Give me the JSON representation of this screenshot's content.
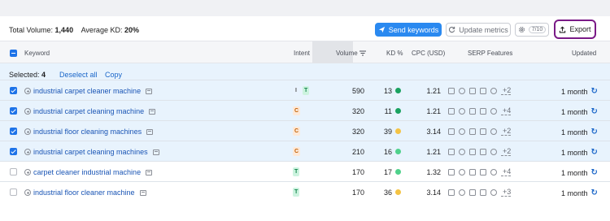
{
  "toolbar": {
    "totals_label": "Total Volume:",
    "totals_value": "1,440",
    "kd_label": "Average KD:",
    "kd_value": "20%",
    "send_label": "Send keywords",
    "update_label": "Update metrics",
    "gear_count": "7/10",
    "export_label": "Export"
  },
  "columns": {
    "keyword": "Keyword",
    "intent": "Intent",
    "volume": "Volume",
    "kd": "KD %",
    "cpc": "CPC (USD)",
    "serp": "SERP Features",
    "updated": "Updated"
  },
  "selection": {
    "label": "Selected:",
    "count": "4",
    "deselect": "Deselect all",
    "copy": "Copy"
  },
  "rows": [
    {
      "keyword": "industrial carpet cleaner machine",
      "intent": [
        "I",
        "T"
      ],
      "volume": "590",
      "kd": "13",
      "kd_color": "#1aa260",
      "cpc": "1.21",
      "more": "+2",
      "updated": "1 month",
      "selected": true
    },
    {
      "keyword": "industrial carpet cleaning machine",
      "intent": [
        "C"
      ],
      "volume": "320",
      "kd": "11",
      "kd_color": "#1aa260",
      "cpc": "1.21",
      "more": "+4",
      "updated": "1 month",
      "selected": true
    },
    {
      "keyword": "industrial floor cleaning machines",
      "intent": [
        "C"
      ],
      "volume": "320",
      "kd": "39",
      "kd_color": "#f4c344",
      "cpc": "3.14",
      "more": "+2",
      "updated": "1 month",
      "selected": true
    },
    {
      "keyword": "industrial carpet cleaning machines",
      "intent": [
        "C"
      ],
      "volume": "210",
      "kd": "16",
      "kd_color": "#4fd18b",
      "cpc": "1.21",
      "more": "+2",
      "updated": "1 month",
      "selected": true
    },
    {
      "keyword": "carpet cleaner industrial machine",
      "intent": [
        "T"
      ],
      "volume": "170",
      "kd": "17",
      "kd_color": "#4fd18b",
      "cpc": "1.32",
      "more": "+4",
      "updated": "1 month",
      "selected": false
    },
    {
      "keyword": "industrial floor cleaner machine",
      "intent": [
        "T"
      ],
      "volume": "170",
      "kd": "36",
      "kd_color": "#f4c344",
      "cpc": "3.14",
      "more": "+3",
      "updated": "1 month",
      "selected": false
    }
  ]
}
